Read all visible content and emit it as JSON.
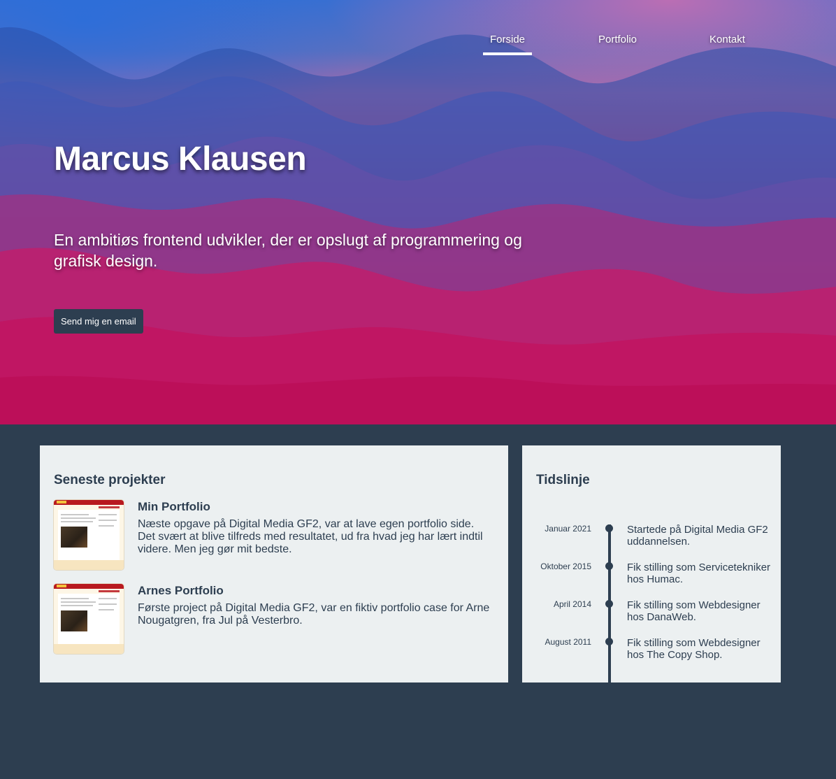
{
  "nav": {
    "items": [
      {
        "label": "Forside",
        "active": true
      },
      {
        "label": "Portfolio",
        "active": false
      },
      {
        "label": "Kontakt",
        "active": false
      }
    ]
  },
  "hero": {
    "title": "Marcus Klausen",
    "subtitle": "En ambitiøs frontend udvikler, der er opslugt af programmering og grafisk design.",
    "button_label": "Send mig en email"
  },
  "projects": {
    "heading": "Seneste projekter",
    "items": [
      {
        "title": "Min Portfolio",
        "description": "Næste opgave på Digital Media GF2, var at lave egen portfolio side. Det svært at blive tilfreds med resultatet, ud fra hvad jeg har lært indtil videre. Men jeg gør mit bedste."
      },
      {
        "title": "Arnes Portfolio",
        "description": "Første project på Digital Media GF2, var en fiktiv portfolio case for Arne Nougatgren, fra Jul på Vesterbro."
      }
    ]
  },
  "timeline": {
    "heading": "Tidslinje",
    "entries": [
      {
        "date": "Januar 2021",
        "text": "Startede på Digital Media GF2 uddannelsen."
      },
      {
        "date": "Oktober 2015",
        "text": "Fik stilling som Servicetekniker hos Humac."
      },
      {
        "date": "April 2014",
        "text": "Fik stilling som Webdesigner hos DanaWeb."
      },
      {
        "date": "August 2011",
        "text": "Fik stilling som Webdesigner hos The Copy Shop."
      }
    ]
  },
  "colors": {
    "dark": "#2d3e50",
    "card": "#ecf0f1",
    "accent_pink": "#e0105a",
    "accent_blue": "#3a6fd0"
  }
}
